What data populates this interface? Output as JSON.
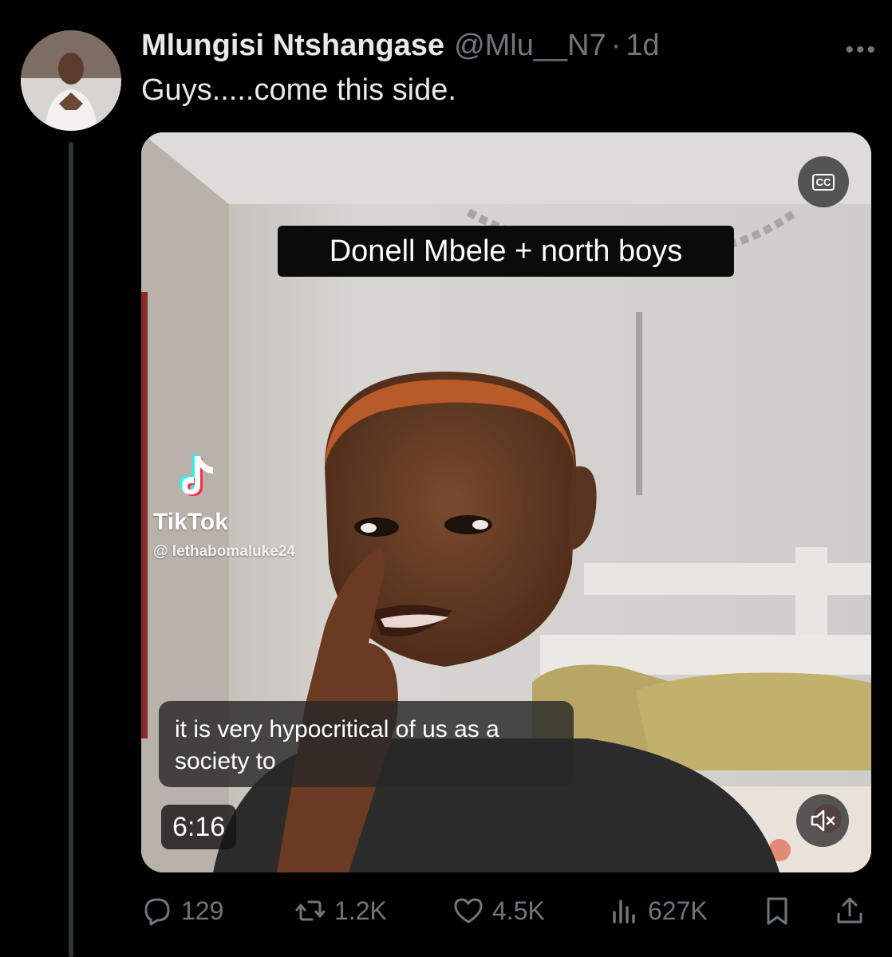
{
  "tweet": {
    "author_name": "Mlungisi Ntshangase",
    "handle": "@Mlu__N7",
    "separator": "·",
    "time": "1d",
    "text": "Guys.....come this side."
  },
  "media": {
    "overlay_title": "Donell Mbele + north boys",
    "watermark_brand": "TikTok",
    "watermark_handle": "@ lethabomaluke24",
    "caption": "it is very hypocritical of us as a society to",
    "duration": "6:16",
    "cc_label": "CC"
  },
  "actions": {
    "replies": "129",
    "reposts": "1.2K",
    "likes": "4.5K",
    "views": "627K"
  },
  "icons": [
    "more-icon",
    "cc-icon",
    "tiktok-logo-icon",
    "mute-icon",
    "reply-icon",
    "repost-icon",
    "like-icon",
    "views-icon",
    "bookmark-icon",
    "share-icon"
  ],
  "colors": {
    "background": "#000000",
    "primary_text": "#e7e9ea",
    "secondary_text": "#71767b",
    "thread_line": "#333639"
  }
}
